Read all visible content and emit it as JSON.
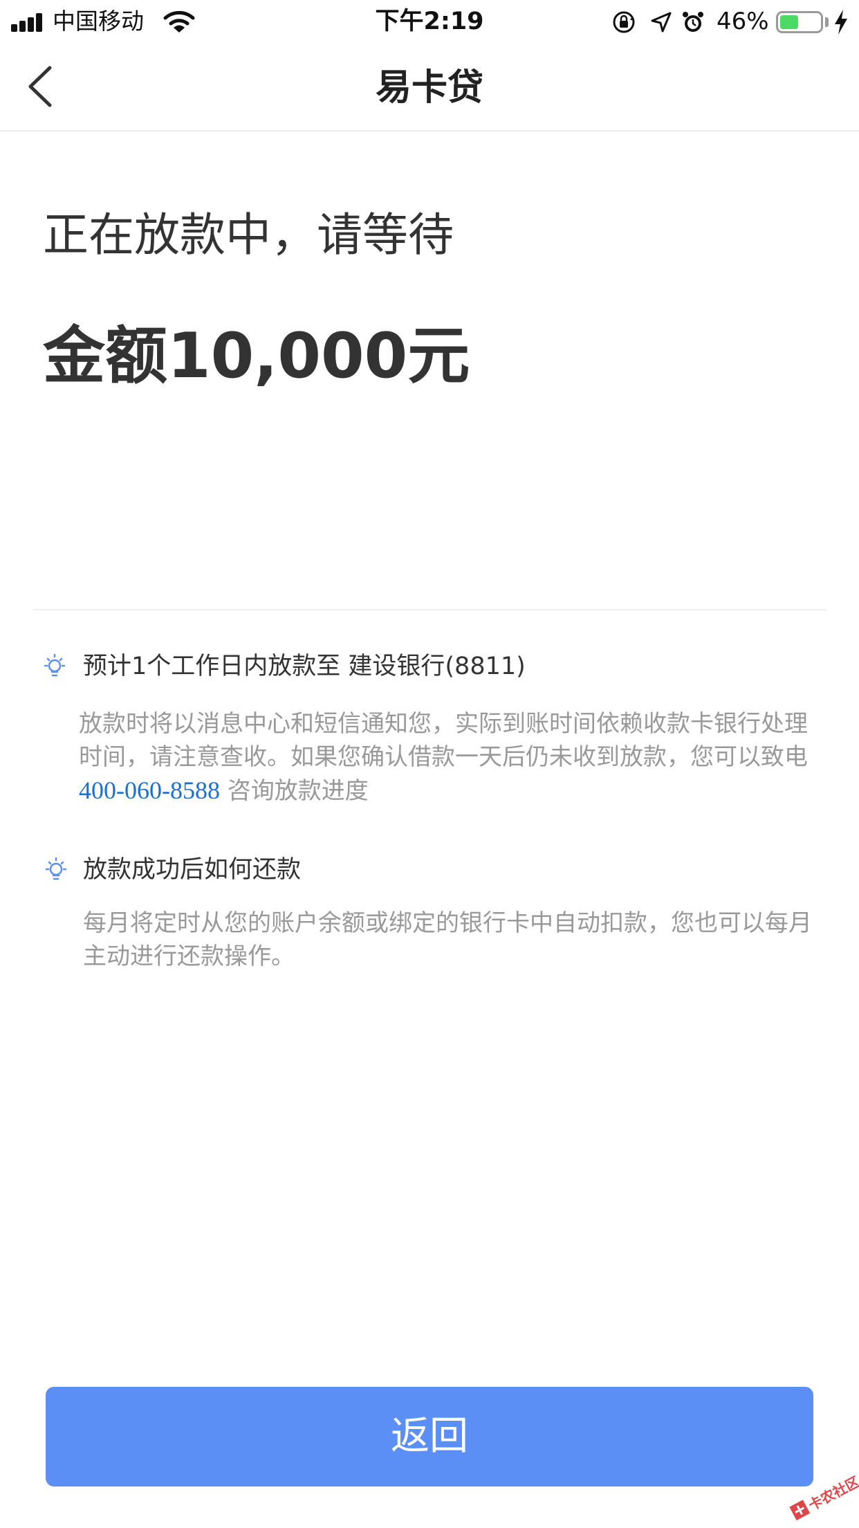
{
  "status_bar": {
    "carrier": "中国移动",
    "time": "下午2:19",
    "battery_percent": "46%",
    "battery_level": 0.46,
    "battery_color": "#4cd964",
    "icons": [
      "signal-icon",
      "wifi-icon",
      "orientation-lock-icon",
      "location-icon",
      "alarm-icon",
      "battery-icon",
      "charging-icon"
    ]
  },
  "nav": {
    "back_icon": "chevron-left-icon",
    "title": "易卡贷"
  },
  "main": {
    "status_heading": "正在放款中，请等待",
    "amount": "金额10,000元"
  },
  "tips": [
    {
      "icon": "lightbulb-icon",
      "title": "预计1个工作日内放款至 建设银行(8811)",
      "body_before": "放款时将以消息中心和短信通知您，实际到账时间依赖收款卡银行处理时间，请注意查收。如果您确认借款一天后仍未收到放款，您可以致电 ",
      "phone": "400-060-8588",
      "body_after": " 咨询放款进度"
    },
    {
      "icon": "lightbulb-icon",
      "title": "放款成功后如何还款",
      "body": "每月将定时从您的账户余额或绑定的银行卡中自动扣款，您也可以每月主动进行还款操作。"
    }
  ],
  "footer": {
    "return_label": "返回",
    "button_color": "#5b8ff5"
  },
  "colors": {
    "link": "#1a6fd4",
    "secondary_text": "#999999",
    "primary_text": "#333333"
  },
  "watermark": {
    "text": "卡农社区"
  }
}
